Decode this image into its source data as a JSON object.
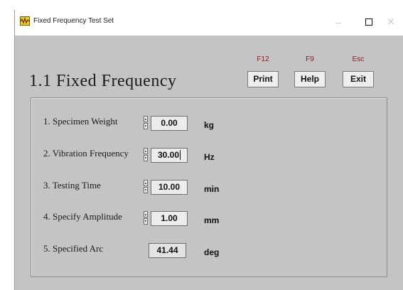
{
  "window": {
    "title": "Fixed Frequency Test Set",
    "minimize": "–",
    "close": "✕"
  },
  "page": {
    "heading": "1.1 Fixed Frequency"
  },
  "toolbar": {
    "print": {
      "key": "F12",
      "label": "Print"
    },
    "help": {
      "key": "F9",
      "label": "Help"
    },
    "exit": {
      "key": "Esc",
      "label": "Exit"
    }
  },
  "params": [
    {
      "label": "1. Specimen Weight",
      "value": "0.00",
      "unit": "kg"
    },
    {
      "label": "2. Vibration Frequency",
      "value": "30.00",
      "unit": "Hz"
    },
    {
      "label": "3. Testing Time",
      "value": "10.00",
      "unit": "min"
    },
    {
      "label": "4. Specify Amplitude",
      "value": "1.00",
      "unit": "mm"
    },
    {
      "label": "5. Specified Arc",
      "value": "41.44",
      "unit": "deg"
    }
  ],
  "colors": {
    "window_bg": "#c4c4c4",
    "function_key": "#8a1a1a",
    "app_icon": "#e9d21a"
  },
  "icons": {
    "app": "waveform-icon",
    "spinner_up": "arrow-up-icon",
    "spinner_down": "arrow-down-icon",
    "maximize": "maximize-icon",
    "minimize": "minimize-icon",
    "close": "close-icon"
  }
}
